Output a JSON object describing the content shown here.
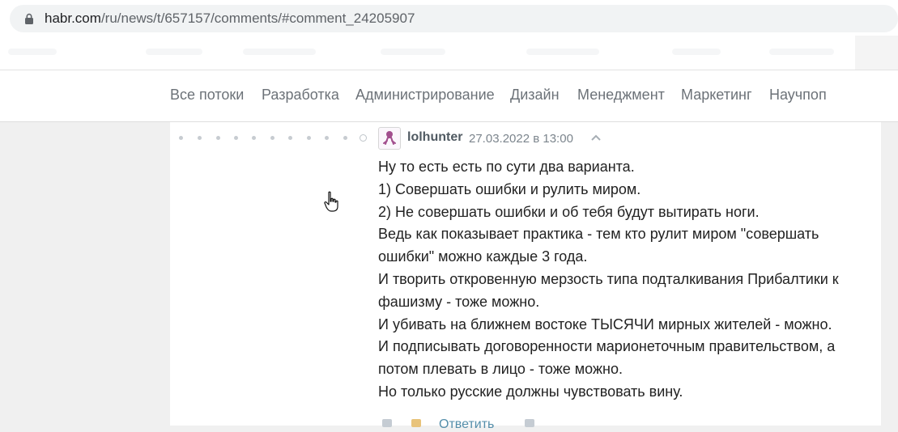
{
  "browser": {
    "url_host": "habr.com",
    "url_path": "/ru/news/t/657157/comments/#comment_24205907"
  },
  "nav": {
    "items": [
      {
        "label": "Все потоки"
      },
      {
        "label": "Разработка"
      },
      {
        "label": "Администрирование"
      },
      {
        "label": "Дизайн"
      },
      {
        "label": "Менеджмент"
      },
      {
        "label": "Маркетинг"
      },
      {
        "label": "Научпоп"
      }
    ]
  },
  "comment": {
    "username": "lolhunter",
    "date": "27.03.2022 в 13:00",
    "lines": [
      "Ну то есть есть по сути два варианта.",
      "1) Совершать ошибки и рулить миром.",
      "2) Не совершать ошибки и об тебя будут вытирать ноги.",
      "Ведь как показывает практика - тем кто рулит миром \"совершать",
      "ошибки\" можно каждые 3 года.",
      "И творить откровенную мерзость типа подталкивания Прибалтики к",
      "фашизму - тоже можно.",
      "И убивать на ближнем востоке ТЫСЯЧИ мирных жителей - можно.",
      "И подписывать договоренности марионеточным правительством, а",
      "потом плевать в лицо - тоже можно.",
      "Но только русские должны чувствовать вину."
    ],
    "reply_label": "Ответить"
  },
  "colors": {
    "nav_text": "#6c7278",
    "link": "#548eaa",
    "body_text": "#222222"
  },
  "icons": [
    "lock-icon",
    "avatar-icon",
    "collapse-chevron-icon",
    "hand-cursor-icon"
  ]
}
